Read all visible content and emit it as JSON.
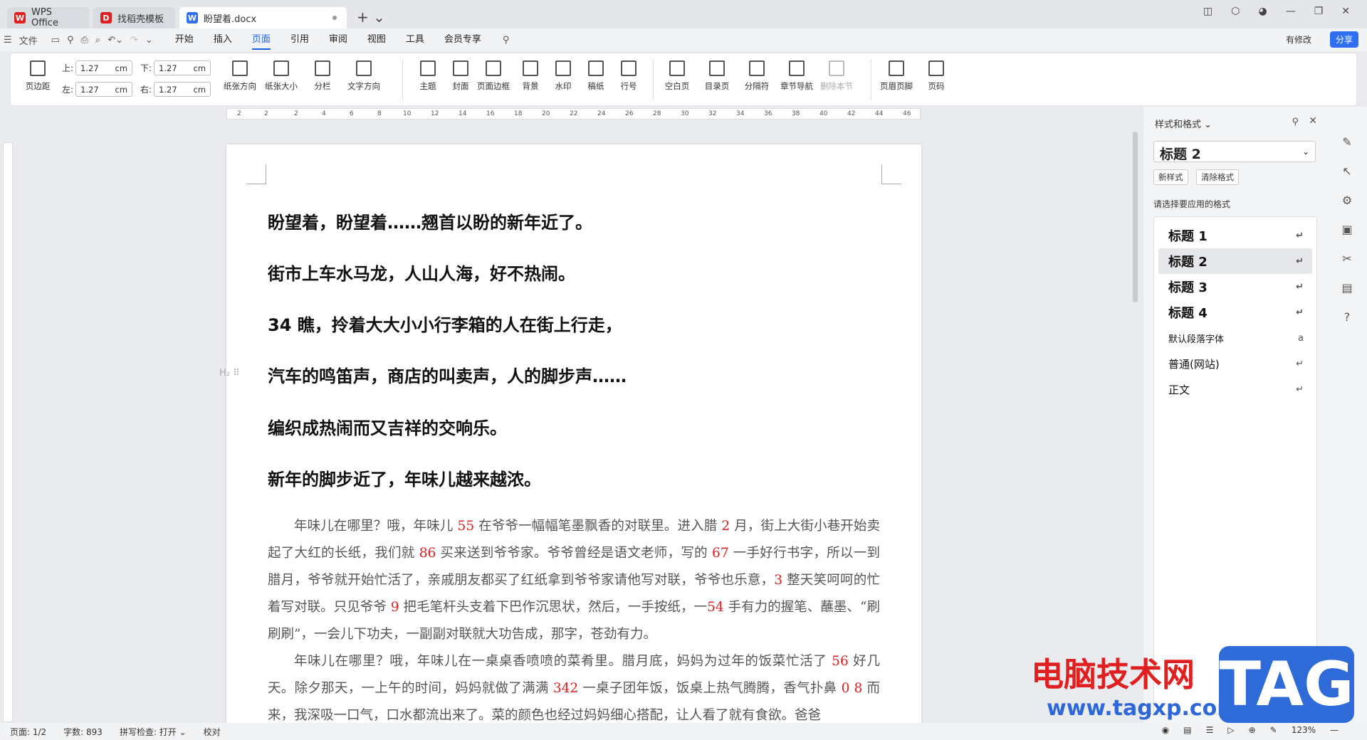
{
  "tabs": [
    {
      "label": "WPS Office",
      "icon": "wps-icon",
      "color": "#e02020"
    },
    {
      "label": "找稻壳模板",
      "icon": "docer-icon",
      "color": "#e02020"
    },
    {
      "label": "盼望着.docx",
      "icon": "word-doc-icon",
      "color": "#2f6ff3"
    }
  ],
  "menu": {
    "file": "文件",
    "items": [
      "开始",
      "插入",
      "页面",
      "引用",
      "审阅",
      "视图",
      "工具",
      "会员专享"
    ],
    "active": "页面",
    "edited": "有修改",
    "share": "分享"
  },
  "ribbon": {
    "margin_top_label": "上:",
    "margin_top": "1.27",
    "margin_bottom_label": "下:",
    "margin_bottom": "1.27",
    "margin_left_label": "左:",
    "margin_left": "1.27",
    "margin_right_label": "右:",
    "margin_right": "1.27",
    "unit": "cm",
    "buttons": [
      "页边距",
      "纸张方向",
      "纸张大小",
      "分栏",
      "文字方向",
      "主题",
      "封面",
      "页面边框",
      "背景",
      "水印",
      "稿纸",
      "行号",
      "空白页",
      "目录页",
      "分隔符",
      "章节导航",
      "删除本节",
      "页眉页脚",
      "页码"
    ]
  },
  "ruler": [
    "2",
    "2",
    "2",
    "4",
    "6",
    "8",
    "10",
    "12",
    "14",
    "16",
    "18",
    "20",
    "22",
    "24",
    "26",
    "28",
    "30",
    "32",
    "34",
    "36",
    "38",
    "40",
    "42",
    "44",
    "46"
  ],
  "document": {
    "headings": [
      "盼望着，盼望着……翘首以盼的新年近了。",
      "街市上车水马龙，人山人海，好不热闹。",
      "34 瞧，拎着大大小小行李箱的人在街上行走，",
      "汽车的鸣笛声，商店的叫卖声，人的脚步声……",
      "编织成热闹而又吉祥的交响乐。",
      "新年的脚步近了，年味儿越来越浓。"
    ],
    "heading_marker": "H₂",
    "para1": [
      {
        "t": "年味儿在哪里？哦，年味儿 "
      },
      {
        "t": "55",
        "red": true
      },
      {
        "t": " 在爷爷一幅幅笔墨飘香的对联里。进入腊 "
      },
      {
        "t": "2",
        "red": true
      },
      {
        "t": " 月，街上大街小巷开始卖起了大红的长纸，我们就 "
      },
      {
        "t": "86",
        "red": true
      },
      {
        "t": " 买来送到爷爷家。爷爷曾经是语文老师，写的 "
      },
      {
        "t": "67",
        "red": true
      },
      {
        "t": " 一手好行书字，所以一到腊月，爷爷就开始忙活了，亲戚朋友都买了红纸拿到爷爷家请他写对联，爷爷也乐意，"
      },
      {
        "t": "3",
        "red": true
      },
      {
        "t": " 整天笑呵呵的忙着写对联。只见爷爷 "
      },
      {
        "t": "9",
        "red": true
      },
      {
        "t": " 把毛笔杆头支着下巴作沉思状，然后，一手按纸，一"
      },
      {
        "t": "54",
        "red": true
      },
      {
        "t": " 手有力的握笔、蘸墨、“刷刷刷”，一会儿下功夫，一副副对联就大功告成，那字，苍劲有力。"
      }
    ],
    "para2": [
      {
        "t": "年味儿在哪里？哦，年味儿在一桌桌香喷喷的菜肴里。腊月底，妈妈为过年的饭菜忙活了 "
      },
      {
        "t": "56",
        "red": true
      },
      {
        "t": " 好几天。除夕那天，一上午的时间，妈妈就做了满满 "
      },
      {
        "t": "342",
        "red": true
      },
      {
        "t": " 一桌子团年饭，饭桌上热气腾腾，香气扑鼻 "
      },
      {
        "t": "0 8",
        "red": true
      },
      {
        "t": " 而来，我深吸一口气，口水都流出来了。菜的颜色也经过妈妈细心搭配，让人看了就有食欲。爸爸"
      }
    ]
  },
  "panel": {
    "title": "样式和格式",
    "current": "标题  2",
    "new_style": "新样式",
    "clear_format": "清除格式",
    "hint": "请选择要应用的格式",
    "styles": [
      {
        "label": "标题  1",
        "bold": true,
        "mark": "↵"
      },
      {
        "label": "标题  2",
        "bold": true,
        "mark": "↵",
        "active": true
      },
      {
        "label": "标题  3",
        "bold": true,
        "mark": "↵"
      },
      {
        "label": "标题  4",
        "bold": true,
        "mark": "↵"
      },
      {
        "label": "默认段落字体",
        "bold": false,
        "mark": "a"
      },
      {
        "label": "普通(网站)",
        "bold": false,
        "mark": "↵"
      },
      {
        "label": "正文",
        "bold": false,
        "mark": "↵"
      }
    ]
  },
  "status": {
    "page": "页面: 1/2",
    "words": "字数: 893",
    "spell": "拼写检查: 打开",
    "proof": "校对",
    "zoom": "123%"
  },
  "watermark": {
    "text": "电脑技术网",
    "url": "www.tagxp.com",
    "tag": "TAG"
  }
}
